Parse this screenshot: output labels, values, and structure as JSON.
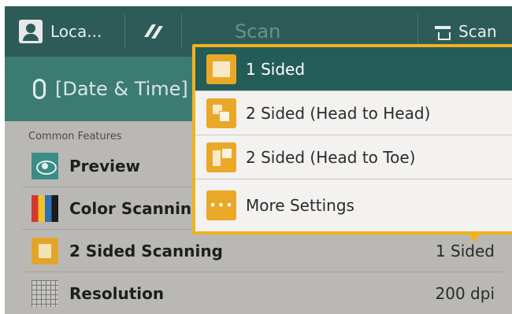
{
  "topbar": {
    "user_label": "Loca...",
    "title": "Scan",
    "scan_label": "Scan"
  },
  "file": {
    "name": "[Date & Time]"
  },
  "features": {
    "section_label": "Common Features",
    "rows": [
      {
        "label": "Preview",
        "value": ""
      },
      {
        "label": "Color Scanning",
        "value": ""
      },
      {
        "label": "2 Sided Scanning",
        "value": "1 Sided"
      },
      {
        "label": "Resolution",
        "value": "200 dpi"
      }
    ]
  },
  "dropdown": {
    "options": [
      {
        "label": "1 Sided",
        "selected": true
      },
      {
        "label": "2 Sided (Head to Head)",
        "selected": false
      },
      {
        "label": "2 Sided (Head to Toe)",
        "selected": false
      },
      {
        "label": "More Settings",
        "selected": false
      }
    ]
  },
  "colors": {
    "topbar": "#2d5c58",
    "filebar": "#3c7b72",
    "accent": "#f2b21e",
    "selected": "#245c57"
  }
}
